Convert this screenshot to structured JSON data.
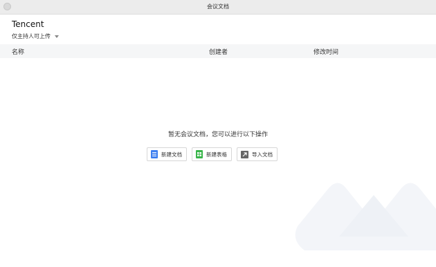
{
  "window": {
    "title": "会议文档"
  },
  "header": {
    "org_name": "Tencent",
    "permission_label": "仅主持人可上传"
  },
  "table": {
    "columns": [
      "名称",
      "创建者",
      "修改时间"
    ]
  },
  "empty_state": {
    "message": "暂无会议文档，您可以进行以下操作"
  },
  "actions": [
    {
      "label": "新建文档",
      "icon": "doc-icon",
      "color": "#3d7ff0"
    },
    {
      "label": "新建表格",
      "icon": "sheet-icon",
      "color": "#39b54a"
    },
    {
      "label": "导入文档",
      "icon": "import-icon",
      "color": "#666666"
    }
  ]
}
